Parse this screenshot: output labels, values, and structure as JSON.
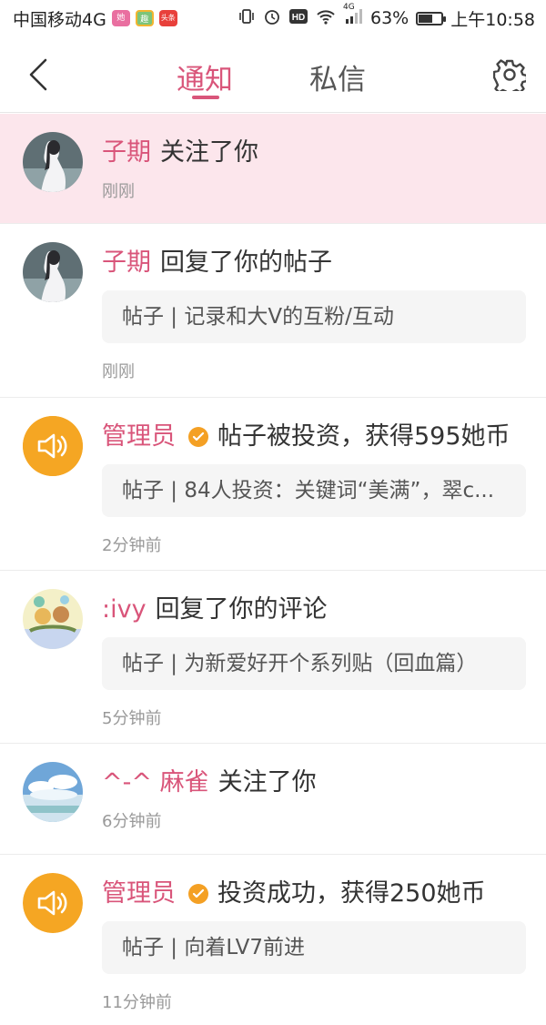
{
  "status_bar": {
    "carrier": "中国移动4G",
    "apps": [
      "她",
      "趣",
      "头条"
    ],
    "network": "4G",
    "battery_percent": "63%",
    "battery_level": 0.63,
    "time": "上午10:58"
  },
  "header": {
    "tabs": [
      {
        "label": "通知",
        "active": true
      },
      {
        "label": "私信",
        "active": false
      }
    ]
  },
  "colors": {
    "accent": "#d9557a",
    "highlight_bg": "#fce6ec",
    "admin_icon": "#f5a623"
  },
  "notifications": [
    {
      "user": "子期",
      "action": "关注了你",
      "quote": "",
      "time": "刚刚",
      "highlight": true,
      "avatar": "girl-photo"
    },
    {
      "user": "子期",
      "action": "回复了你的帖子",
      "quote": "帖子 | 记录和大V的互粉/互动",
      "time": "刚刚",
      "highlight": false,
      "avatar": "girl-photo"
    },
    {
      "user": "管理员",
      "verified": true,
      "action": "帖子被投资，获得595她币",
      "quote": "帖子 | 84人投资：关键词“美满”，翠c...",
      "time": "2分钟前",
      "avatar": "speaker-icon"
    },
    {
      "user": ":ivy",
      "action": "回复了你的评论",
      "quote": "帖子 | 为新爱好开个系列贴（回血篇）",
      "time": "5分钟前",
      "avatar": "cartoon-photo"
    },
    {
      "user": "^-^ 麻雀",
      "action": "关注了你",
      "quote": "",
      "time": "6分钟前",
      "avatar": "sky-photo"
    },
    {
      "user": "管理员",
      "verified": true,
      "action": "投资成功，获得250她币",
      "quote": "帖子 | 向着LV7前进",
      "time": "11分钟前",
      "avatar": "speaker-icon"
    }
  ]
}
